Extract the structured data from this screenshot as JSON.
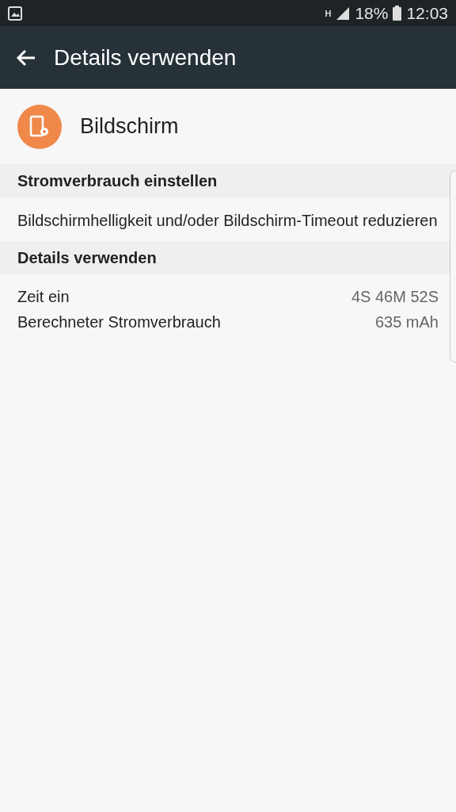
{
  "status_bar": {
    "network_type": "H",
    "battery": "18%",
    "time": "12:03"
  },
  "app_bar": {
    "title": "Details verwenden"
  },
  "app": {
    "name": "Bildschirm"
  },
  "sections": [
    {
      "header": "Stromverbrauch einstellen",
      "kind": "text",
      "text": "Bildschirmhelligkeit und/oder Bildschirm-Timeout reduzieren"
    },
    {
      "header": "Details verwenden",
      "kind": "rows",
      "rows": [
        {
          "label": "Zeit ein",
          "value": "4S 46M 52S"
        },
        {
          "label": "Berechneter Stromverbrauch",
          "value": "635 mAh"
        }
      ]
    }
  ]
}
